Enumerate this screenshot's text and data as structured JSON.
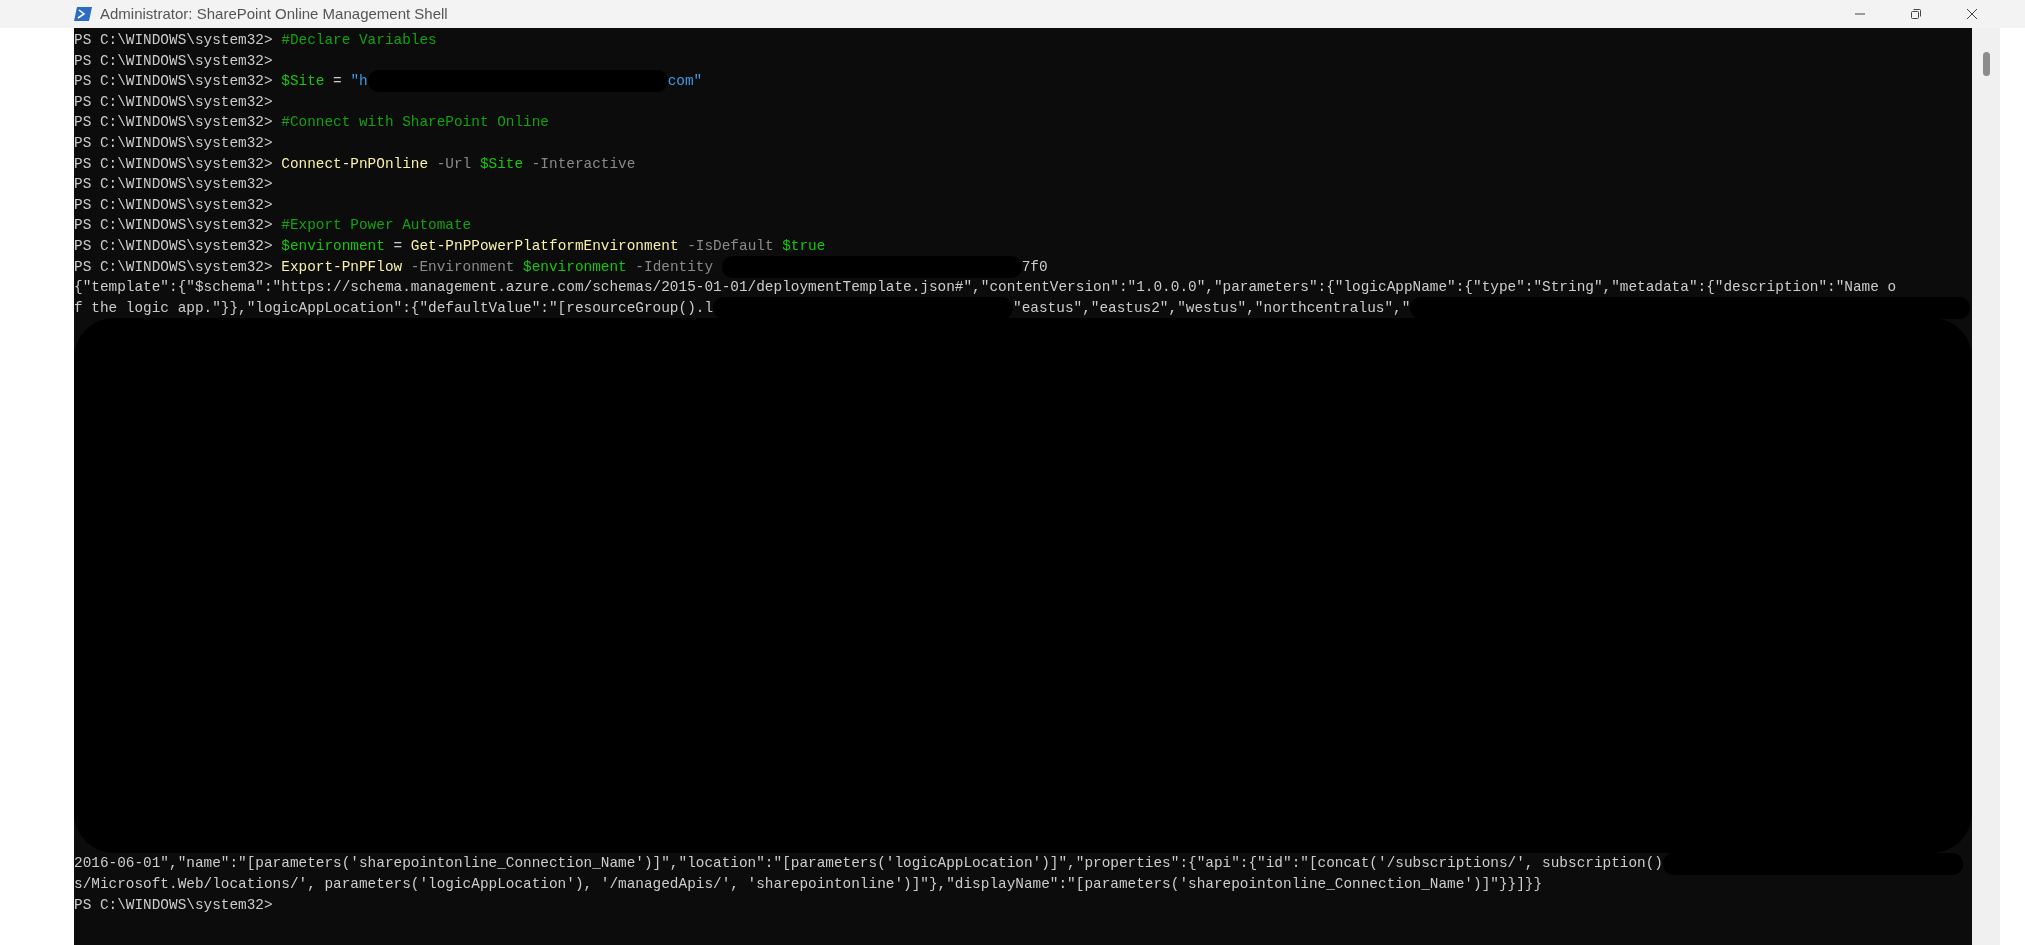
{
  "window": {
    "title": "Administrator: SharePoint Online Management Shell"
  },
  "console": {
    "lines": [
      {
        "segments": [
          {
            "kind": "prompt",
            "text": "PS C:\\WINDOWS\\system32> "
          },
          {
            "kind": "comment",
            "text": "#Declare Variables"
          }
        ]
      },
      {
        "segments": [
          {
            "kind": "prompt",
            "text": "PS C:\\WINDOWS\\system32> "
          }
        ]
      },
      {
        "segments": [
          {
            "kind": "prompt",
            "text": "PS C:\\WINDOWS\\system32> "
          },
          {
            "kind": "variable",
            "text": "$Site"
          },
          {
            "kind": "plain",
            "text": " = "
          },
          {
            "kind": "string",
            "text": "\"h"
          },
          {
            "kind": "scribble"
          },
          {
            "kind": "string",
            "text": "com\""
          }
        ]
      },
      {
        "segments": [
          {
            "kind": "prompt",
            "text": "PS C:\\WINDOWS\\system32> "
          }
        ]
      },
      {
        "segments": [
          {
            "kind": "prompt",
            "text": "PS C:\\WINDOWS\\system32> "
          },
          {
            "kind": "comment",
            "text": "#Connect with SharePoint Online"
          }
        ]
      },
      {
        "segments": [
          {
            "kind": "prompt",
            "text": "PS C:\\WINDOWS\\system32> "
          }
        ]
      },
      {
        "segments": [
          {
            "kind": "prompt",
            "text": "PS C:\\WINDOWS\\system32> "
          },
          {
            "kind": "command",
            "text": "Connect-PnPOnline"
          },
          {
            "kind": "param",
            "text": " -Url "
          },
          {
            "kind": "variable",
            "text": "$Site"
          },
          {
            "kind": "param",
            "text": " -Interactive"
          }
        ]
      },
      {
        "segments": [
          {
            "kind": "prompt",
            "text": "PS C:\\WINDOWS\\system32> "
          }
        ]
      },
      {
        "segments": [
          {
            "kind": "prompt",
            "text": "PS C:\\WINDOWS\\system32> "
          }
        ]
      },
      {
        "segments": [
          {
            "kind": "prompt",
            "text": "PS C:\\WINDOWS\\system32> "
          },
          {
            "kind": "comment",
            "text": "#Export Power Automate"
          }
        ]
      },
      {
        "segments": [
          {
            "kind": "prompt",
            "text": "PS C:\\WINDOWS\\system32> "
          },
          {
            "kind": "variable",
            "text": "$environment"
          },
          {
            "kind": "plain",
            "text": " = "
          },
          {
            "kind": "command",
            "text": "Get-PnPPowerPlatformEnvironment"
          },
          {
            "kind": "param",
            "text": " -IsDefault "
          },
          {
            "kind": "variable",
            "text": "$true"
          }
        ]
      },
      {
        "segments": [
          {
            "kind": "prompt",
            "text": "PS C:\\WINDOWS\\system32> "
          },
          {
            "kind": "command",
            "text": "Export-PnPFlow"
          },
          {
            "kind": "param",
            "text": " -Environment "
          },
          {
            "kind": "variable",
            "text": "$environment"
          },
          {
            "kind": "param",
            "text": " -Identity "
          },
          {
            "kind": "scribble"
          },
          {
            "kind": "plain",
            "text": "7f0"
          }
        ]
      },
      {
        "segments": [
          {
            "kind": "plain",
            "text": "{\"template\":{\"$schema\":\"https://schema.management.azure.com/schemas/2015-01-01/deploymentTemplate.json#\",\"contentVersion\":\"1.0.0.0\",\"parameters\":{\"logicAppName\":{\"type\":\"String\",\"metadata\":{\"description\":\"Name o"
          }
        ]
      },
      {
        "segments": [
          {
            "kind": "plain",
            "text": "f the logic app.\"}},\"logicAppLocation\":{\"defaultValue\":\"[resourceGroup().l"
          },
          {
            "kind": "scribble"
          },
          {
            "kind": "plain",
            "text": "\"eastus\",\"eastus2\",\"westus\",\"northcentralus\",\""
          },
          {
            "kind": "smear"
          }
        ]
      },
      {
        "segments": [
          {
            "kind": "blackout"
          }
        ]
      },
      {
        "segments": [
          {
            "kind": "plain",
            "text": "2016-06-01\",\"name\":\"[parameters('sharepointonline_Connection_Name')]\",\"location\":\"[parameters('logicAppLocation')]\",\"properties\":{\"api\":{\"id\":\"[concat('/subscriptions/', subscription()"
          },
          {
            "kind": "scribble"
          }
        ]
      },
      {
        "segments": [
          {
            "kind": "plain",
            "text": "s/Microsoft.Web/locations/', parameters('logicAppLocation'), '/managedApis/', 'sharepointonline')]\"},\"displayName\":\"[parameters('sharepointonline_Connection_Name')]\"}}]}}"
          }
        ]
      },
      {
        "segments": [
          {
            "kind": "prompt",
            "text": "PS C:\\WINDOWS\\system32> "
          }
        ]
      }
    ]
  }
}
